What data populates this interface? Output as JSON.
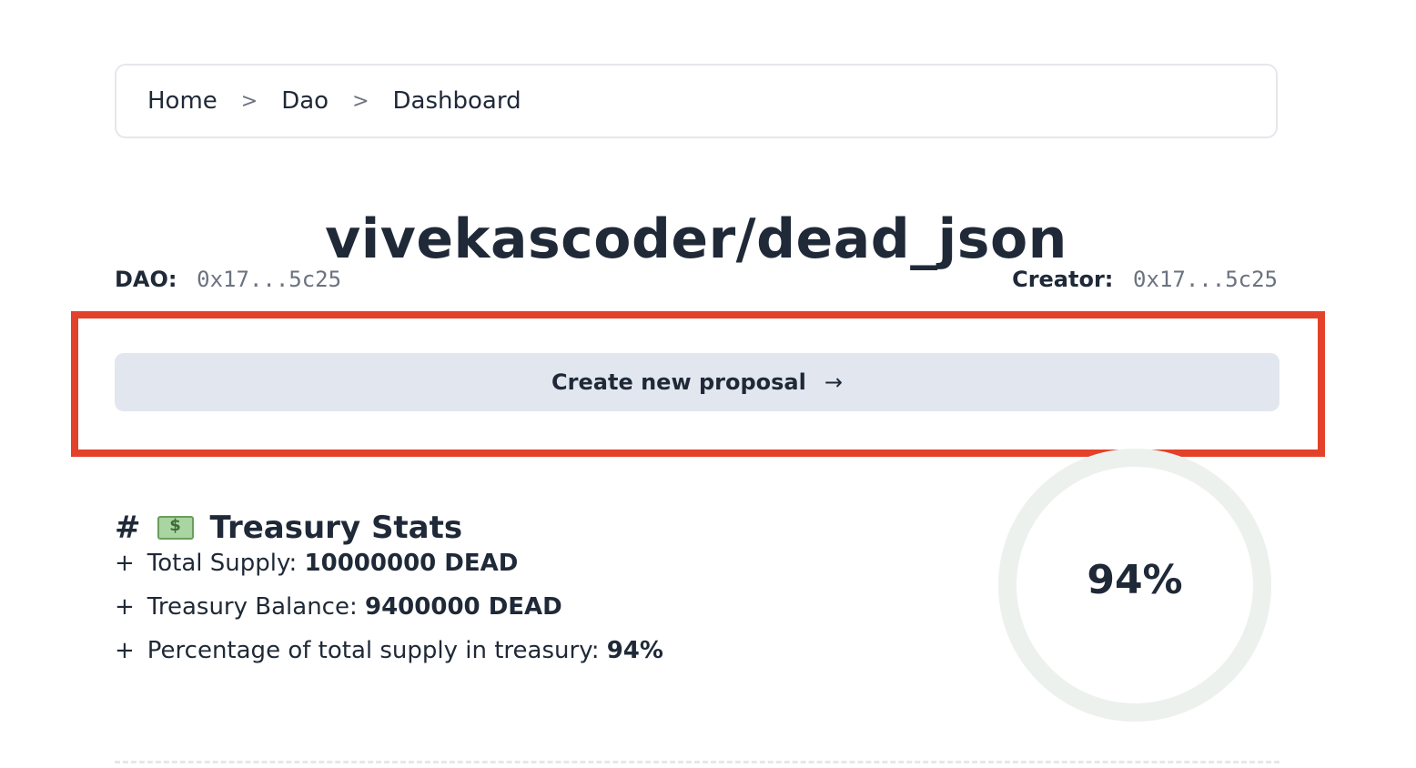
{
  "breadcrumb": {
    "items": [
      "Home",
      "Dao",
      "Dashboard"
    ],
    "separator": ">"
  },
  "title": "vivekascoder/dead_json",
  "meta": {
    "dao_label": "DAO:",
    "dao_value": "0x17...5c25",
    "creator_label": "Creator:",
    "creator_value": "0x17...5c25"
  },
  "proposal_button": {
    "label": "Create new proposal",
    "arrow": "→"
  },
  "treasury": {
    "hash": "#",
    "icon": "money-bag-icon",
    "heading": "Treasury Stats",
    "rows": [
      {
        "bullet": "+",
        "label": "Total Supply:",
        "value": "10000000 DEAD"
      },
      {
        "bullet": "+",
        "label": "Treasury Balance:",
        "value": "9400000 DEAD"
      },
      {
        "bullet": "+",
        "label": "Percentage of total supply in treasury:",
        "value": "94%"
      }
    ]
  },
  "gauge": {
    "percent": 94,
    "label": "94%"
  },
  "colors": {
    "highlight": "#e3412a",
    "button_bg": "#e2e6ee",
    "gauge_track": "#edf1ee"
  }
}
